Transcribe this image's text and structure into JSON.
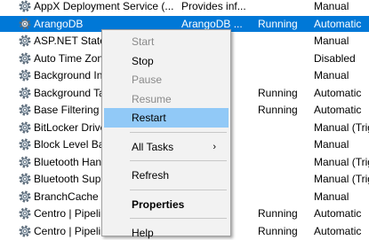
{
  "services": [
    {
      "name": "AppX Deployment Service (...",
      "description": "Provides inf...",
      "status": "",
      "startup": "Manual"
    },
    {
      "name": "ArangoDB",
      "description": "ArangoDB ...",
      "status": "Running",
      "startup": "Automatic",
      "selected": true
    },
    {
      "name": "ASP.NET State Service",
      "description": "",
      "status": "",
      "startup": "Manual"
    },
    {
      "name": "Auto Time Zone Updater",
      "description": "",
      "status": "",
      "startup": "Disabled"
    },
    {
      "name": "Background Intelligent Transfer",
      "description": "",
      "status": "",
      "startup": "Manual"
    },
    {
      "name": "Background Tasks Infrastructure",
      "description": "",
      "status": "Running",
      "startup": "Automatic"
    },
    {
      "name": "Base Filtering Engine",
      "description": "",
      "status": "Running",
      "startup": "Automatic"
    },
    {
      "name": "BitLocker Drive Encryption",
      "description": "",
      "status": "",
      "startup": "Manual (Trig"
    },
    {
      "name": "Block Level Backup Engine",
      "description": "",
      "status": "",
      "startup": "Manual"
    },
    {
      "name": "Bluetooth Handsfree Service",
      "description": "",
      "status": "",
      "startup": "Manual (Trig"
    },
    {
      "name": "Bluetooth Support Service",
      "description": "",
      "status": "",
      "startup": "Manual (Trig"
    },
    {
      "name": "BranchCache",
      "description": "",
      "status": "",
      "startup": "Manual"
    },
    {
      "name": "Centro | Pipeline Service",
      "description": "",
      "status": "Running",
      "startup": "Automatic"
    },
    {
      "name": "Centro | Pipeline Service",
      "description": "",
      "status": "Running",
      "startup": "Automatic"
    }
  ],
  "context_menu": {
    "items": [
      {
        "label": "Start",
        "disabled": true
      },
      {
        "label": "Stop",
        "disabled": false
      },
      {
        "label": "Pause",
        "disabled": true
      },
      {
        "label": "Resume",
        "disabled": true
      },
      {
        "label": "Restart",
        "disabled": false,
        "highlighted": true
      },
      {
        "separator": true
      },
      {
        "label": "All Tasks",
        "submenu": true
      },
      {
        "separator": true
      },
      {
        "label": "Refresh"
      },
      {
        "separator": true
      },
      {
        "label": "Properties",
        "bold": true
      },
      {
        "separator": true
      },
      {
        "label": "Help"
      }
    ],
    "submenu_arrow": "›"
  },
  "icons": {
    "service": "gear-icon"
  },
  "colors": {
    "selection": "#0078d7",
    "menu_hover": "#91c9f7",
    "menu_bg": "#f2f2f2"
  }
}
